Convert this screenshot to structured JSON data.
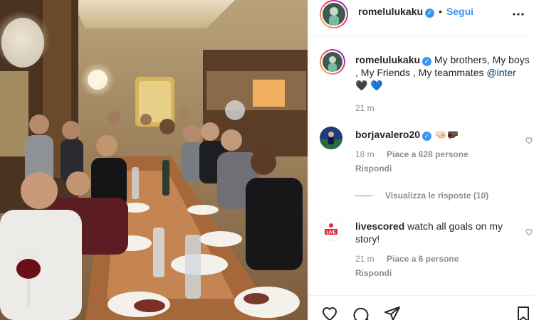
{
  "post": {
    "image_alt": "Group dinner photo at a restaurant table",
    "author": "romelulukaku",
    "verified": true,
    "dot": "•",
    "follow_label": "Segui"
  },
  "caption": {
    "username": "romelulukaku",
    "text": "My brothers, My boys , My Friends , My teammates",
    "mention": "@inter",
    "emoji": "🖤 💙",
    "time": "21 m"
  },
  "comments": [
    {
      "username": "borjavalero20",
      "verified": true,
      "text": "🤜🏻🤛🏿",
      "time": "18 m",
      "likes": "Piace a 628 persone",
      "reply": "Rispondi",
      "view_replies": "Visualizza le risposte (10)"
    },
    {
      "username": "livescored",
      "verified": false,
      "text": "watch all goals on my story!",
      "time": "21 m",
      "likes": "Piace a 6 persone",
      "reply": "Rispondi",
      "avatar_text": "LIVE"
    }
  ],
  "icons": {
    "more": "more-options-icon",
    "like": "heart-icon",
    "comment": "comment-icon",
    "share": "share-icon",
    "save": "bookmark-icon"
  },
  "colors": {
    "accent": "#3897f0",
    "muted": "#8e8e8e",
    "text": "#262626",
    "live_red": "#e0282e"
  }
}
